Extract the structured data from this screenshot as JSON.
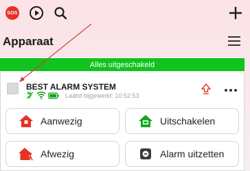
{
  "toolbar": {
    "sos_label": "SOS"
  },
  "section": {
    "title": "Apparaat"
  },
  "status": {
    "text": "Alles uitgeschakeld",
    "color": "#11c31e"
  },
  "device": {
    "name": "BEST ALARM SYSTEM",
    "updated": "Laatst bijgewerkt: 10:52:53"
  },
  "actions": [
    {
      "label": "Aanwezig",
      "icon": "home-arm-icon",
      "color": "#e53226"
    },
    {
      "label": "Uitschakelen",
      "icon": "home-disarm-icon",
      "color": "#11a81b"
    },
    {
      "label": "Afwezig",
      "icon": "away-arm-icon",
      "color": "#e53226"
    },
    {
      "label": "Alarm uitzetten",
      "icon": "alarm-off-icon",
      "color": "#3b3b3b"
    }
  ],
  "colors": {
    "accent_red": "#e53226",
    "status_green": "#11c31e"
  }
}
